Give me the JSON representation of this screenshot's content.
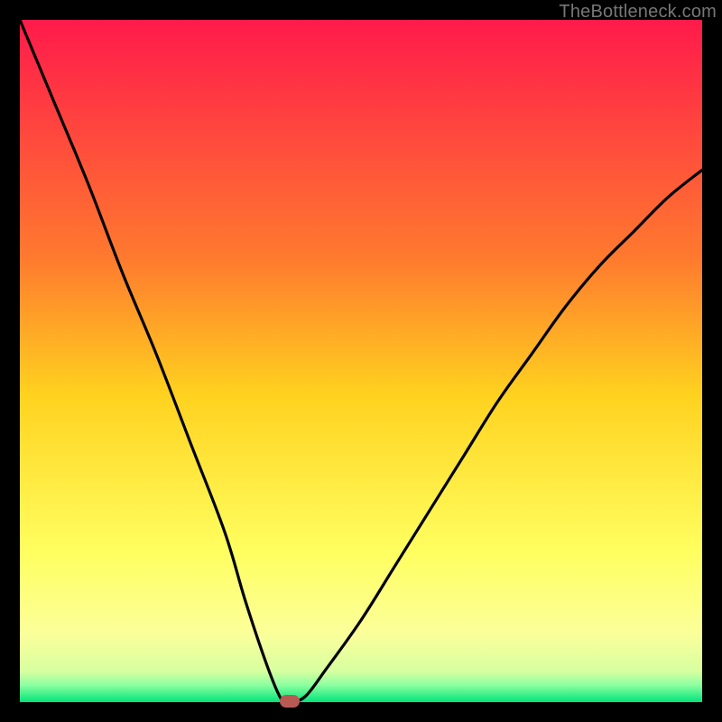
{
  "watermark": "TheBottleneck.com",
  "chart_data": {
    "type": "line",
    "title": "",
    "xlabel": "",
    "ylabel": "",
    "xlim": [
      0,
      100
    ],
    "ylim": [
      0,
      100
    ],
    "x": [
      0,
      5,
      10,
      15,
      20,
      25,
      30,
      33,
      36,
      38,
      39,
      40,
      42,
      45,
      50,
      55,
      60,
      65,
      70,
      75,
      80,
      85,
      90,
      95,
      100
    ],
    "values": [
      100,
      88,
      76,
      63,
      51,
      38,
      25,
      15,
      6,
      1,
      0,
      0,
      1,
      5,
      12,
      20,
      28,
      36,
      44,
      51,
      58,
      64,
      69,
      74,
      78
    ],
    "series": [
      {
        "name": "bottleneck-curve",
        "color": "#000000"
      }
    ],
    "marker": {
      "x": 39.5,
      "y": 0,
      "color": "#b85a54"
    },
    "gradient_stops": [
      {
        "pct": 0,
        "color": "#ff1a4b"
      },
      {
        "pct": 35,
        "color": "#ff7a2e"
      },
      {
        "pct": 55,
        "color": "#ffd21f"
      },
      {
        "pct": 78,
        "color": "#ffff60"
      },
      {
        "pct": 90,
        "color": "#fbff9a"
      },
      {
        "pct": 95.5,
        "color": "#d7ffa0"
      },
      {
        "pct": 97.5,
        "color": "#8cffa0"
      },
      {
        "pct": 100,
        "color": "#00e47a"
      }
    ]
  }
}
